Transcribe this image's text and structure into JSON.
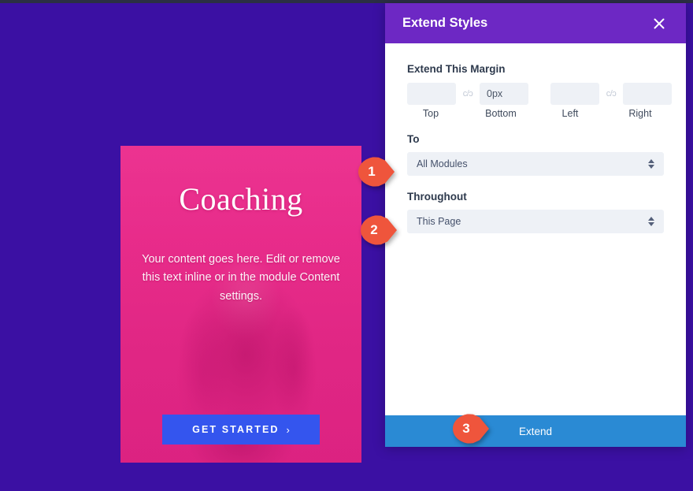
{
  "theme": {
    "page_bg": "#3b10a3",
    "panel_header_bg": "#6d28c4",
    "panel_bg": "#ffffff",
    "extend_button_bg": "#2a8ad4",
    "badge_color": "#ef553c",
    "card_bg": "#e8338a",
    "cta_bg": "#3455ee"
  },
  "card": {
    "title": "Coaching",
    "body": "Your content goes here. Edit or remove this text inline or in the module Content settings.",
    "cta_label": "GET STARTED",
    "cta_chevron": "›"
  },
  "panel": {
    "title": "Extend Styles",
    "close_icon": "close-icon",
    "margin": {
      "label": "Extend This Margin",
      "fields": [
        {
          "name": "top",
          "value": "",
          "placeholder": "",
          "caption": "Top"
        },
        {
          "name": "bottom",
          "value": "0px",
          "placeholder": "",
          "caption": "Bottom"
        },
        {
          "name": "left",
          "value": "",
          "placeholder": "",
          "caption": "Left"
        },
        {
          "name": "right",
          "value": "",
          "placeholder": "",
          "caption": "Right"
        }
      ],
      "link_icon_glyph": "c/ɔ"
    },
    "to": {
      "label": "To",
      "value": "All Modules",
      "options": [
        "All Modules"
      ]
    },
    "throughout": {
      "label": "Throughout",
      "value": "This Page",
      "options": [
        "This Page"
      ]
    },
    "footer": {
      "extend_label": "Extend"
    }
  },
  "callouts": [
    {
      "number": "1",
      "target": "to-select"
    },
    {
      "number": "2",
      "target": "throughout-select"
    },
    {
      "number": "3",
      "target": "extend-button"
    }
  ]
}
